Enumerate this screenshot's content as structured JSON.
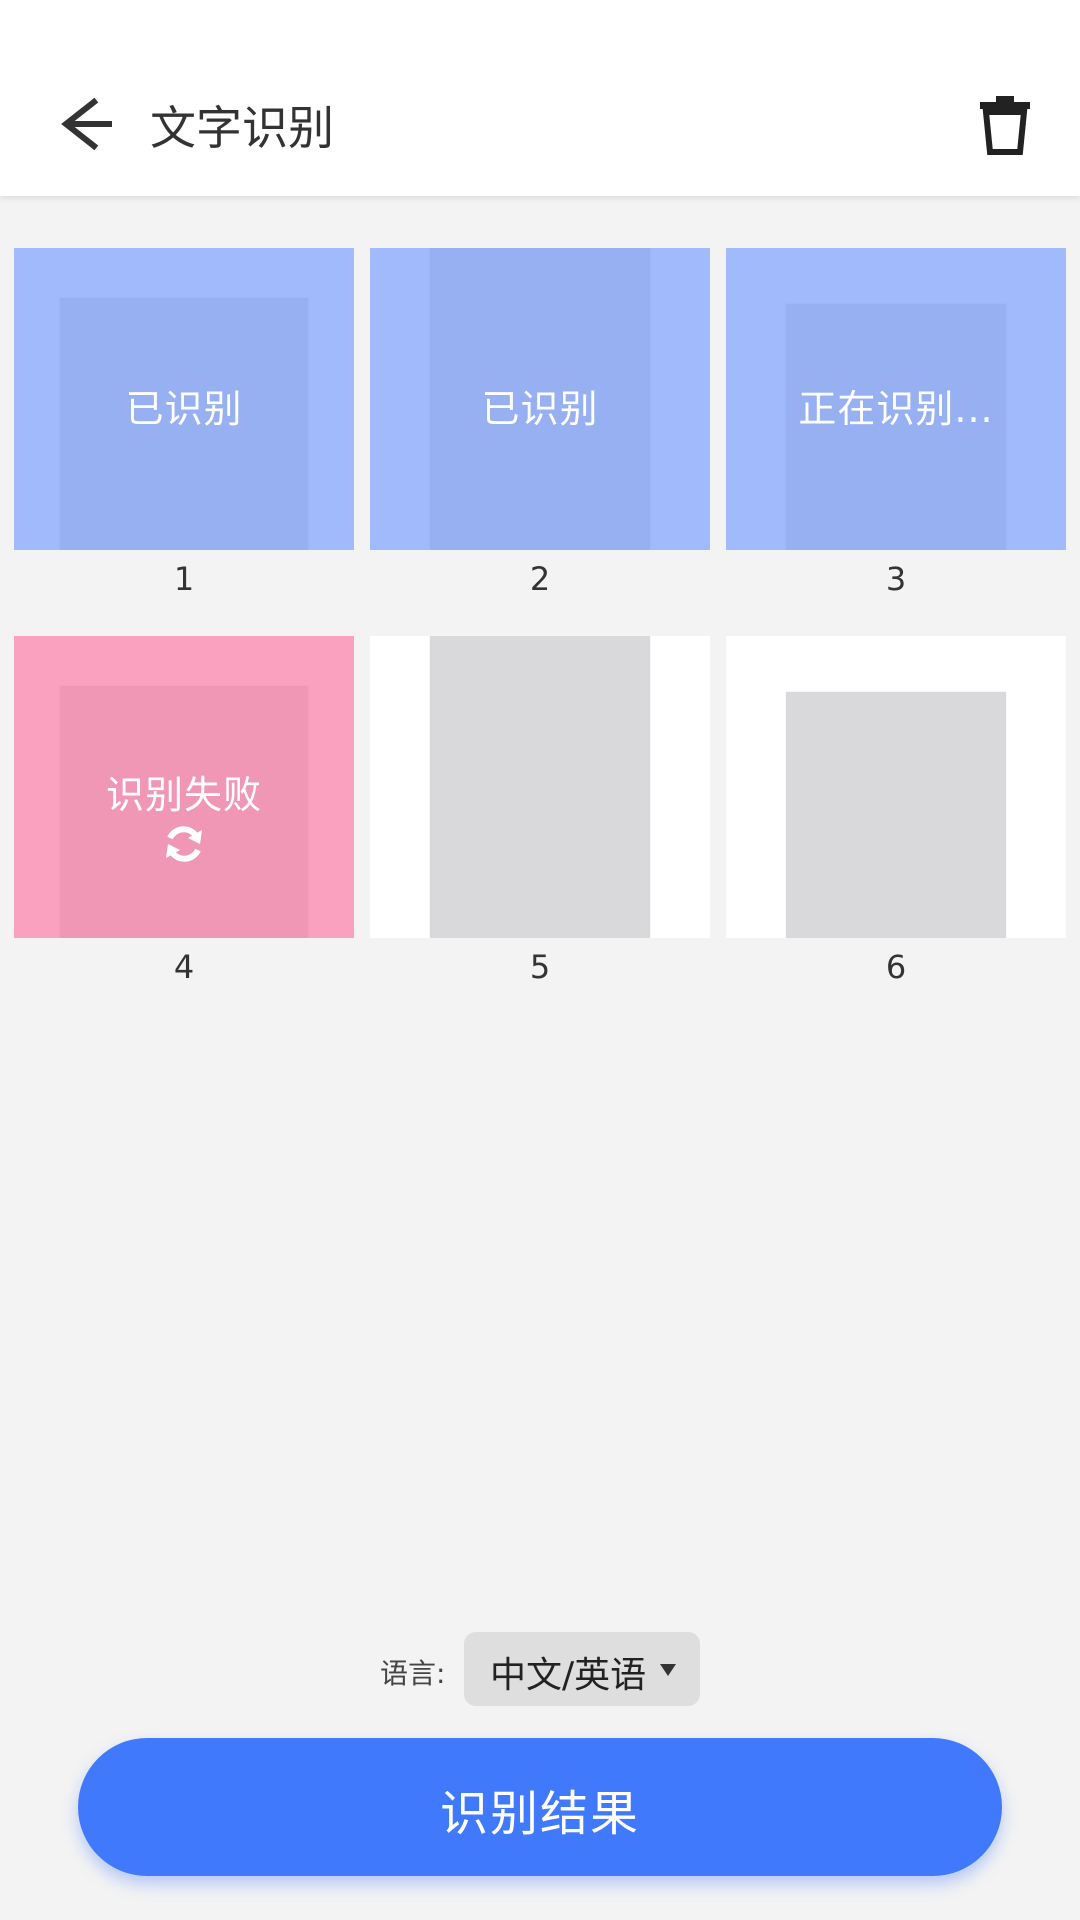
{
  "header": {
    "title": "文字识别",
    "back_icon": "arrow-left-icon",
    "delete_icon": "trash-icon"
  },
  "pages": [
    {
      "number": "1",
      "status": "已识别",
      "state": "done"
    },
    {
      "number": "2",
      "status": "已识别",
      "state": "done"
    },
    {
      "number": "3",
      "status": "正在识别...",
      "state": "processing"
    },
    {
      "number": "4",
      "status": "识别失败",
      "state": "failed",
      "retry_icon": "refresh-icon"
    },
    {
      "number": "5",
      "status": "",
      "state": "none"
    },
    {
      "number": "6",
      "status": "",
      "state": "none"
    }
  ],
  "language": {
    "label": "语言:",
    "value": "中文/英语"
  },
  "result_button": {
    "label": "识别结果"
  },
  "colors": {
    "recognized_overlay": "#6e96ff",
    "failed_overlay": "#ff6ea0",
    "primary_button": "#4079fb"
  }
}
